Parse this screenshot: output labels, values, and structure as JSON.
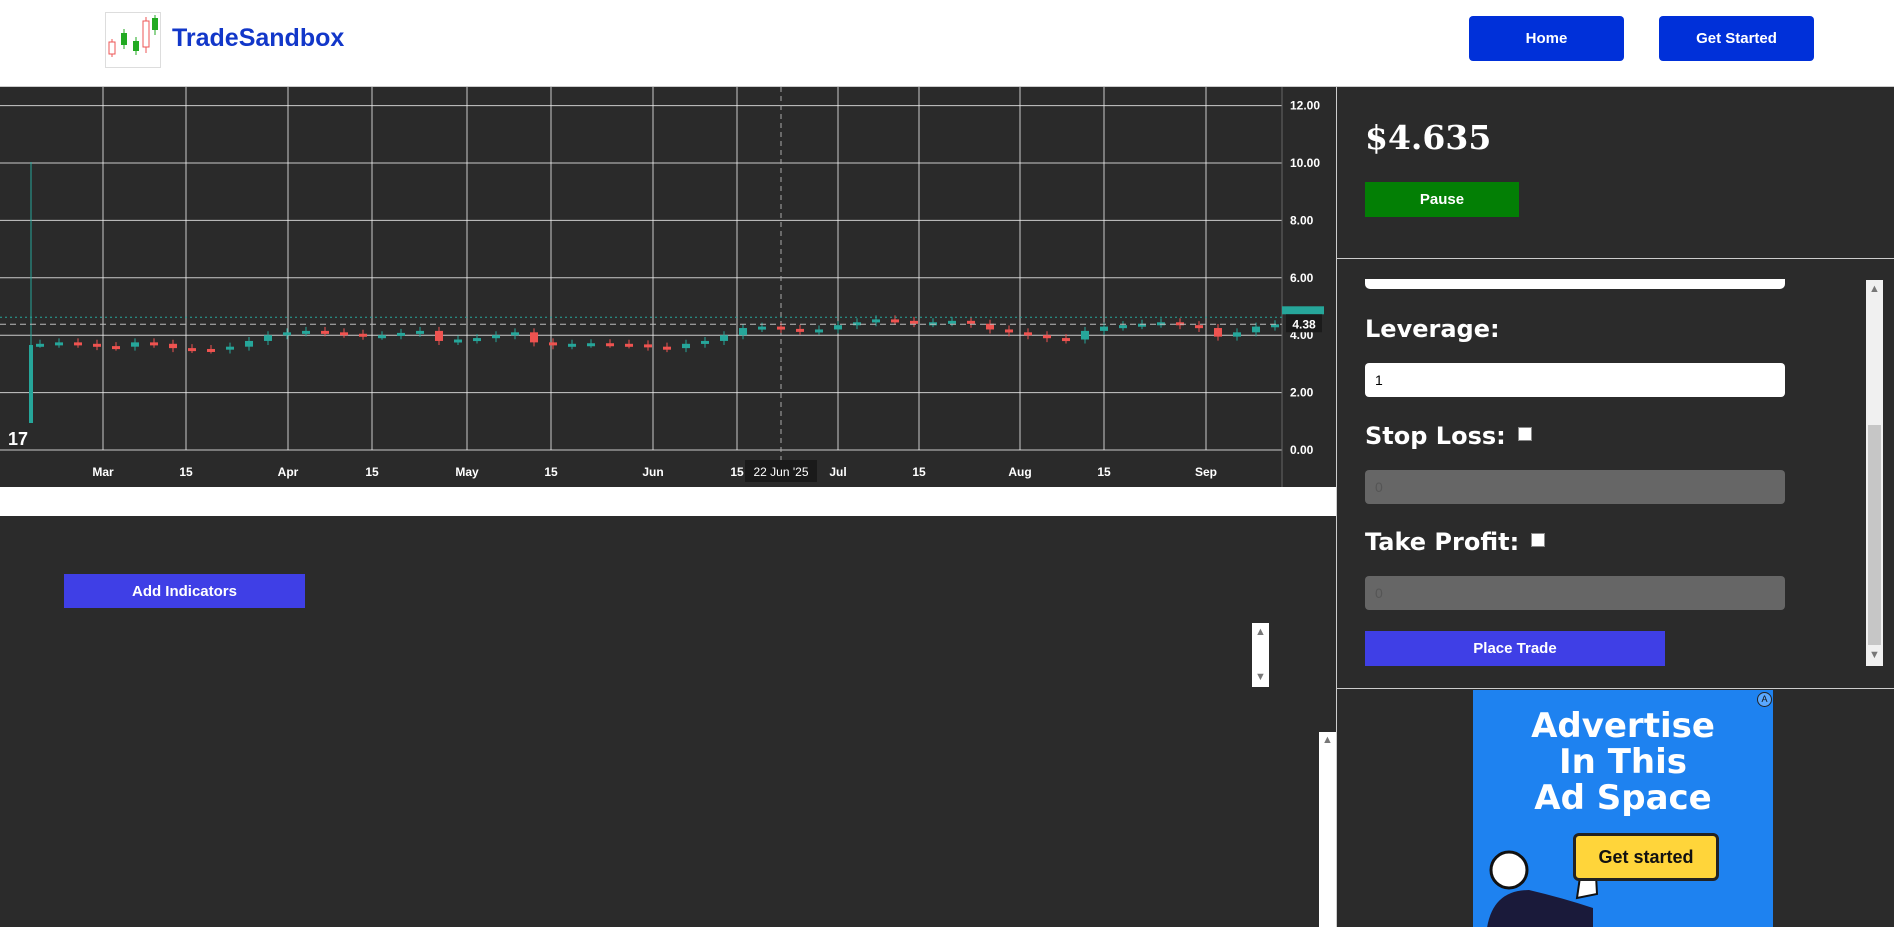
{
  "header": {
    "brand": "TradeSandbox",
    "nav": {
      "home": "Home",
      "get_started": "Get Started"
    }
  },
  "chart_data": {
    "type": "line",
    "x_ticks": [
      "Mar",
      "15",
      "Apr",
      "15",
      "May",
      "15",
      "Jun",
      "15",
      "Jul",
      "15",
      "Aug",
      "15",
      "Sep"
    ],
    "y_ticks": [
      "12.00",
      "10.00",
      "8.00",
      "6.00",
      "4.00",
      "2.00",
      "0.00"
    ],
    "ylim": [
      0,
      12.5
    ],
    "last_price_label": "4.38",
    "crosshair_date": "22 Jun '25",
    "series": [
      {
        "values": [
          3.7,
          3.75,
          3.7,
          3.62,
          3.6,
          3.75,
          3.7,
          3.55,
          3.52,
          3.5,
          3.6,
          3.8,
          4.0,
          4.1,
          4.15,
          4.1,
          4.05,
          3.98,
          4.0,
          4.08,
          4.15,
          3.8,
          3.85,
          3.9,
          4.0,
          4.1,
          3.75,
          3.65,
          3.7,
          3.72,
          3.7,
          3.68,
          3.6,
          3.55,
          3.7,
          3.8,
          4.0,
          4.25,
          4.3,
          4.22,
          4.15,
          4.2,
          4.35,
          4.45,
          4.55,
          4.5,
          4.42,
          4.45,
          4.5,
          4.4,
          4.2,
          4.1,
          4.0,
          3.9,
          3.85,
          4.15,
          4.3,
          4.35,
          4.4,
          4.45,
          4.35,
          4.25,
          3.95,
          4.1,
          4.3,
          4.38
        ]
      }
    ]
  },
  "trading_panel": {
    "price": "$4.635",
    "pause_label": "Pause",
    "leverage_label": "Leverage:",
    "leverage_value": "1",
    "stop_loss_label": "Stop Loss:",
    "stop_loss_placeholder": "0",
    "take_profit_label": "Take Profit:",
    "take_profit_placeholder": "0",
    "place_trade_label": "Place Trade"
  },
  "indicators": {
    "add_label": "Add Indicators"
  },
  "ad": {
    "headline_line1": "Advertise",
    "headline_line2": "In This",
    "headline_line3": "Ad Space",
    "cta": "Get started"
  },
  "colors": {
    "up": "#26a69a",
    "down": "#ef5350",
    "brand": "#1237c9",
    "nav_button": "#0030d9",
    "pause": "#037f05",
    "action": "#3f3fe6"
  }
}
